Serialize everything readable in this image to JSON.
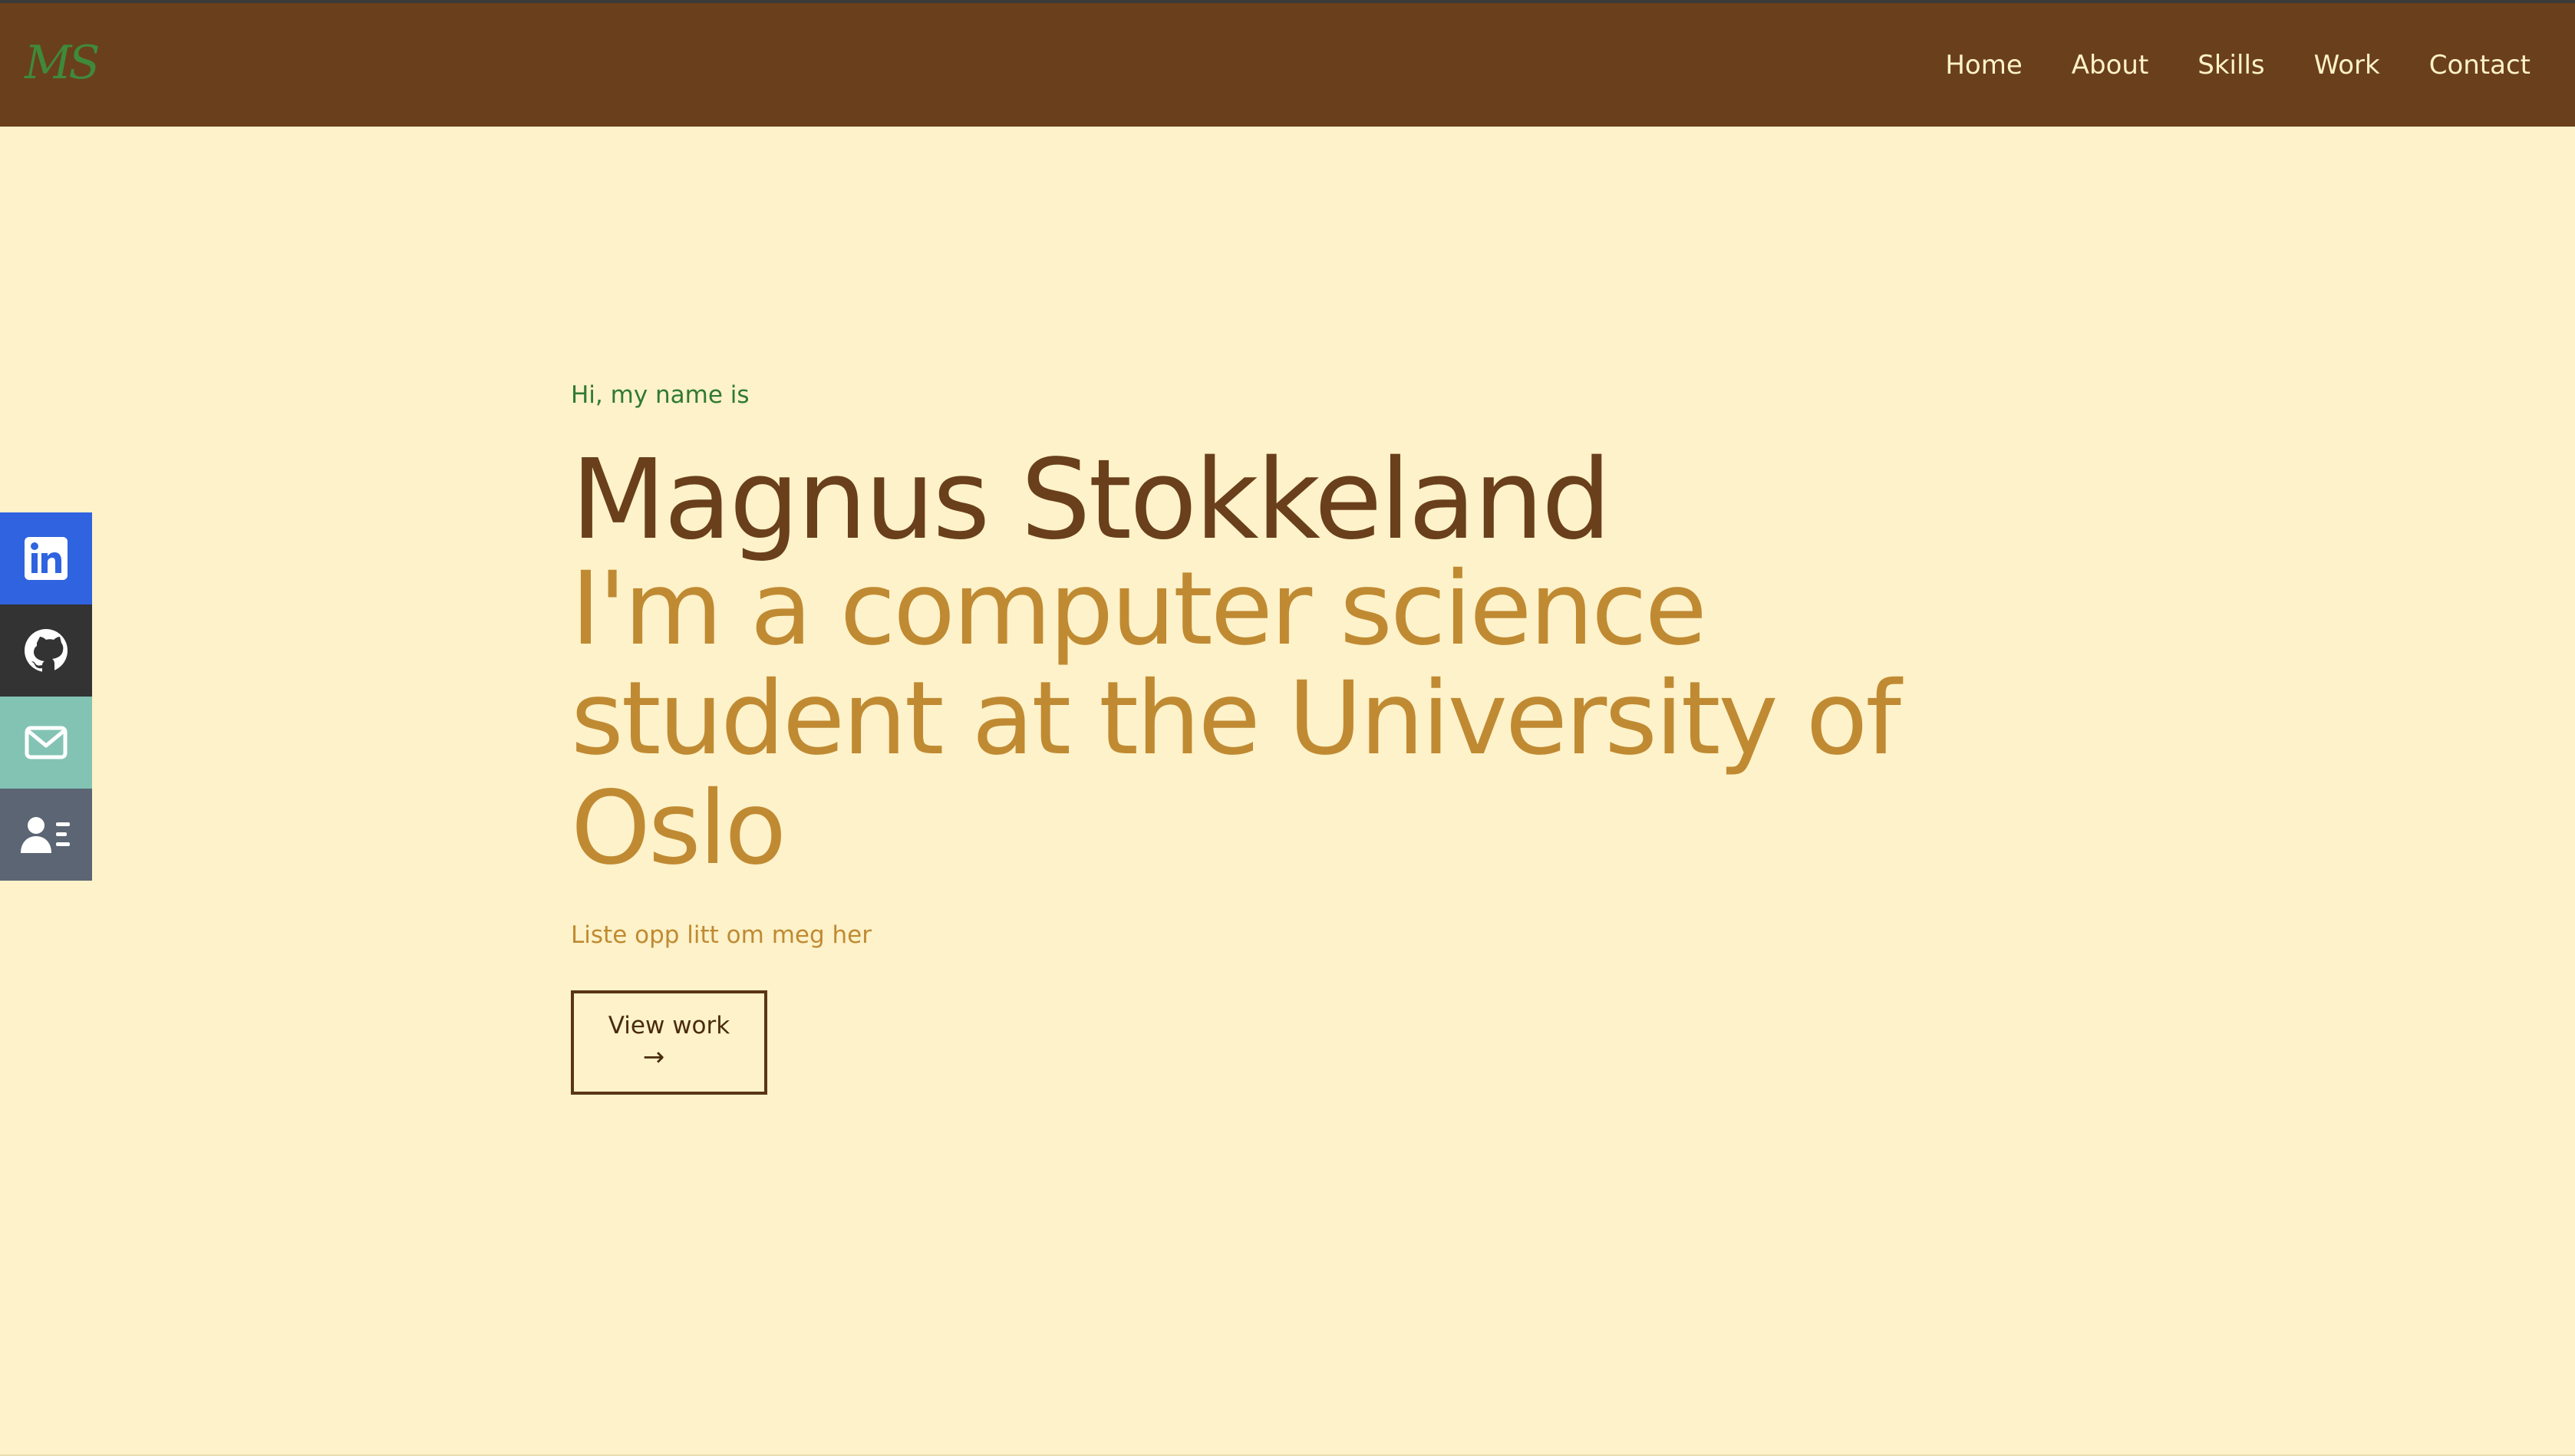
{
  "header": {
    "logo": "MS",
    "nav": [
      {
        "label": "Home"
      },
      {
        "label": "About"
      },
      {
        "label": "Skills"
      },
      {
        "label": "Work"
      },
      {
        "label": "Contact"
      }
    ]
  },
  "social": [
    {
      "icon": "linkedin-icon",
      "color": "#2f63e0"
    },
    {
      "icon": "github-icon",
      "color": "#333333"
    },
    {
      "icon": "mail-icon",
      "color": "#83c3b4"
    },
    {
      "icon": "contact-card-icon",
      "color": "#5b6573"
    }
  ],
  "hero": {
    "greeting": "Hi, my name is",
    "name": "Magnus Stokkeland",
    "tagline": "I'm a computer science student at the University of Oslo",
    "description": "Liste opp litt om meg her",
    "cta_label": "View work",
    "cta_arrow": "→"
  },
  "colors": {
    "background": "#fdf2c9",
    "navbar": "#6a3f1c",
    "accent_green": "#2f7a32",
    "accent_gold": "#c08a33",
    "heading_brown": "#6a3f1c"
  }
}
